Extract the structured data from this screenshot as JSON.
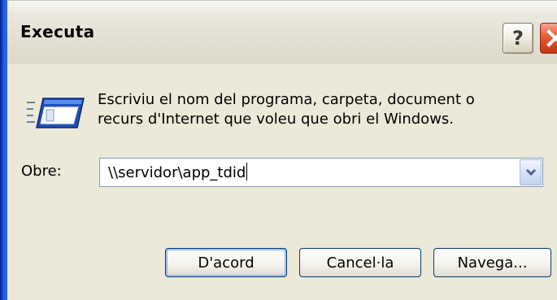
{
  "window": {
    "title": "Executa",
    "help_label": "?",
    "close_label": "close"
  },
  "dialog": {
    "description_line1": "Escriviu el nom del programa, carpeta, document o",
    "description_line2": "recurs d'Internet que voleu que obri el Windows.",
    "open_label": "Obre:",
    "open_value": "\\\\servidor\\app_tdid",
    "icon": "run-icon"
  },
  "buttons": {
    "ok": "D'acord",
    "cancel": "Cancel·la",
    "browse": "Navega..."
  },
  "colors": {
    "frame_blue": "#0831d9",
    "dialog_bg": "#ece9d8",
    "close_red": "#e5613d",
    "field_border": "#7f9db9"
  }
}
